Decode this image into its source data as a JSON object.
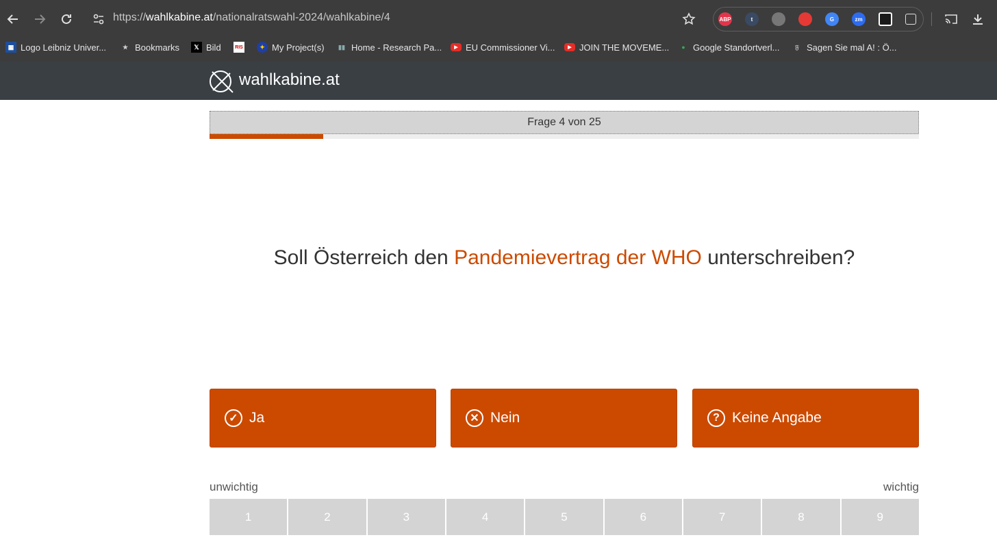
{
  "browser": {
    "url_prefix": "https://",
    "url_host": "wahlkabine.at",
    "url_path": "/nationalratswahl-2024/wahlkabine/4",
    "extensions": [
      {
        "name": "adblock-plus-icon",
        "label": "ABP",
        "color": "#e2354b"
      },
      {
        "name": "tumblr-icon",
        "label": "t",
        "color": "#3b4a63"
      },
      {
        "name": "pie-chart-icon",
        "label": "",
        "color": "#777777"
      },
      {
        "name": "sync-icon",
        "label": "",
        "color": "#e53935"
      },
      {
        "name": "google-translate-icon",
        "label": "G",
        "color": "#4285f4"
      },
      {
        "name": "zoom-icon",
        "label": "zm",
        "color": "#2d6cf0"
      },
      {
        "name": "play-extension-icon",
        "label": "",
        "color": "#1a1a1a"
      },
      {
        "name": "puzzle-icon",
        "label": "",
        "color": "#3c3c3c"
      }
    ]
  },
  "bookmarks": [
    {
      "label": "Logo Leibniz Univer...",
      "icon": "leibniz-logo-icon"
    },
    {
      "label": "Bookmarks",
      "icon": "star-icon"
    },
    {
      "label": "Bild",
      "icon": "x-icon"
    },
    {
      "label": "",
      "icon": "ris-icon",
      "icon_text": "RIS"
    },
    {
      "label": "My Project(s)",
      "icon": "eu-flag-icon"
    },
    {
      "label": "Home - Research Pa...",
      "icon": "research-icon"
    },
    {
      "label": "EU Commissioner Vi...",
      "icon": "youtube-icon"
    },
    {
      "label": "JOIN THE MOVEME...",
      "icon": "youtube-icon"
    },
    {
      "label": "Google Standortverl...",
      "icon": "maps-pin-icon"
    },
    {
      "label": "Sagen Sie mal A! : Ö...",
      "icon": "fraktur-icon"
    }
  ],
  "site": {
    "name": "wahlkabine.at"
  },
  "progress": {
    "label": "Frage 4 von 25",
    "current": 4,
    "total": 25
  },
  "question": {
    "before": "Soll Österreich den ",
    "highlight": "Pandemievertrag der WHO",
    "after": " unterschreiben?"
  },
  "answers": [
    {
      "label": "Ja",
      "icon": "check-circle-icon",
      "glyph": "✓"
    },
    {
      "label": "Nein",
      "icon": "x-circle-icon",
      "glyph": "✕"
    },
    {
      "label": "Keine Angabe",
      "icon": "question-circle-icon",
      "glyph": "?"
    }
  ],
  "importance": {
    "low_label": "unwichtig",
    "high_label": "wichtig",
    "levels": [
      "1",
      "2",
      "3",
      "4",
      "5",
      "6",
      "7",
      "8",
      "9"
    ]
  },
  "colors": {
    "accent": "#cc4a00",
    "header_bg": "#3a3f44",
    "scale_bg": "#d4d4d4"
  }
}
